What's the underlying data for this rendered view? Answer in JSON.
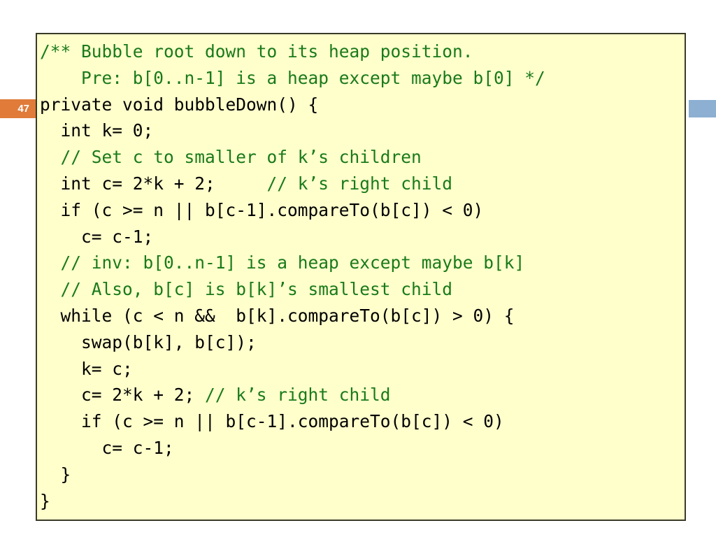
{
  "slide": {
    "number": "47",
    "badge_color": "#e07b39",
    "accent_bar_color": "#8cafd2"
  },
  "code_block": {
    "background_color": "#ffffcc",
    "border_color": "#3a3a28",
    "code_color": "#000000",
    "comment_color": "#1a7a1a",
    "language": "java",
    "lines": [
      [
        {
          "t": "comment",
          "s": "/** Bubble root down to its heap position."
        }
      ],
      [
        {
          "t": "comment",
          "s": "    Pre: b[0..n-1] is a heap except maybe b[0] */"
        }
      ],
      [
        {
          "t": "code",
          "s": "private void bubbleDown() {"
        }
      ],
      [
        {
          "t": "code",
          "s": "  int k= 0;"
        }
      ],
      [
        {
          "t": "code",
          "s": "  "
        },
        {
          "t": "comment",
          "s": "// Set c to smaller of k’s children"
        }
      ],
      [
        {
          "t": "code",
          "s": "  int c= 2*k + 2;     "
        },
        {
          "t": "comment",
          "s": "// k’s right child"
        }
      ],
      [
        {
          "t": "code",
          "s": "  if (c >= n || b[c-1].compareTo(b[c]) < 0)"
        }
      ],
      [
        {
          "t": "code",
          "s": "    c= c-1;"
        }
      ],
      [
        {
          "t": "code",
          "s": "  "
        },
        {
          "t": "comment",
          "s": "// inv: b[0..n-1] is a heap except maybe b[k]"
        }
      ],
      [
        {
          "t": "code",
          "s": "  "
        },
        {
          "t": "comment",
          "s": "// Also, b[c] is b[k]’s smallest child"
        }
      ],
      [
        {
          "t": "code",
          "s": "  while (c < n &&  b[k].compareTo(b[c]) > 0) {"
        }
      ],
      [
        {
          "t": "code",
          "s": "    swap(b[k], b[c]);"
        }
      ],
      [
        {
          "t": "code",
          "s": "    k= c;"
        }
      ],
      [
        {
          "t": "code",
          "s": "    c= 2*k + 2; "
        },
        {
          "t": "comment",
          "s": "// k’s right child"
        }
      ],
      [
        {
          "t": "code",
          "s": "    if (c >= n || b[c-1].compareTo(b[c]) < 0)"
        }
      ],
      [
        {
          "t": "code",
          "s": "      c= c-1;"
        }
      ],
      [
        {
          "t": "code",
          "s": "  }"
        }
      ],
      [
        {
          "t": "code",
          "s": "}"
        }
      ]
    ]
  }
}
